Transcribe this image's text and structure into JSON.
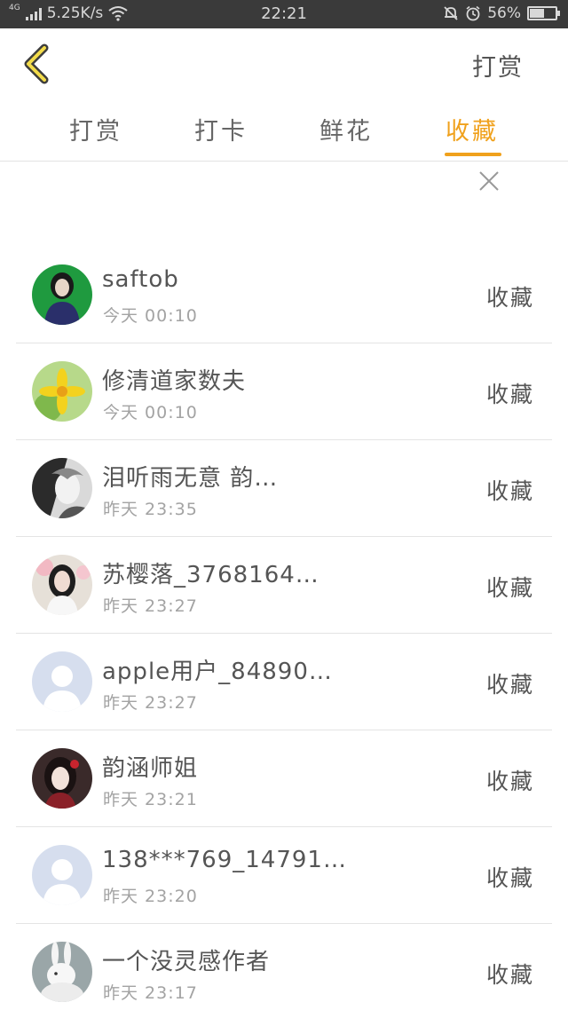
{
  "status_bar": {
    "network": "4G",
    "speed": "5.25K/s",
    "time": "22:21",
    "battery": "56%",
    "battery_level": 0.56
  },
  "header": {
    "back_icon": "chevron-left-icon",
    "action_label": "打赏",
    "accent_color": "#f0a11c"
  },
  "tabs": [
    {
      "label": "打赏",
      "active": false
    },
    {
      "label": "打卡",
      "active": false
    },
    {
      "label": "鲜花",
      "active": false
    },
    {
      "label": "收藏",
      "active": true
    }
  ],
  "close_icon": "close-icon",
  "users": [
    {
      "name": "saftob",
      "time": "今天 00:10",
      "status": "收藏"
    },
    {
      "name": "修清道家数夫",
      "time": "今天 00:10",
      "status": "收藏"
    },
    {
      "name": "泪听雨无意 韵…",
      "time": "昨天 23:35",
      "status": "收藏"
    },
    {
      "name": "苏樱落_3768164…",
      "time": "昨天 23:27",
      "status": "收藏"
    },
    {
      "name": "apple用户_84890…",
      "time": "昨天 23:27",
      "status": "收藏"
    },
    {
      "name": "韵涵师姐",
      "time": "昨天 23:21",
      "status": "收藏"
    },
    {
      "name": "138***769_14791…",
      "time": "昨天 23:20",
      "status": "收藏"
    },
    {
      "name": "一个没灵感作者",
      "time": "昨天 23:17",
      "status": "收藏"
    }
  ]
}
